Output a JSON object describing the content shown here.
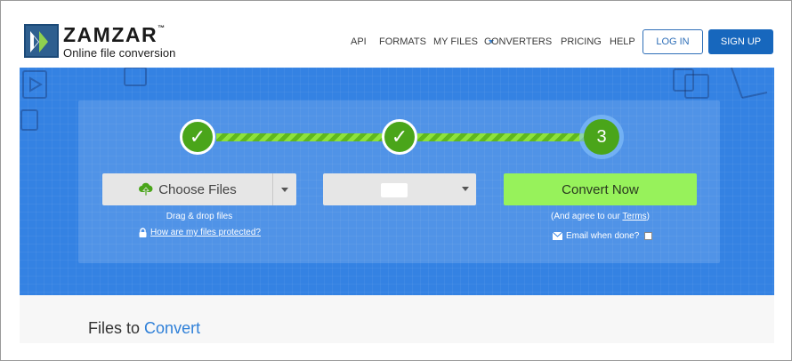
{
  "brand": {
    "name": "ZAMZAR",
    "trademark": "™",
    "tagline": "Online file conversion"
  },
  "nav": {
    "items": [
      {
        "id": "api",
        "label": "API"
      },
      {
        "id": "formats",
        "label": "FORMATS"
      },
      {
        "id": "my-files",
        "label": "MY FILES"
      },
      {
        "id": "converters",
        "label": "CONVERTERS"
      },
      {
        "id": "pricing",
        "label": "PRICING"
      },
      {
        "id": "help",
        "label": "HELP"
      }
    ],
    "login_label": "LOG IN",
    "signup_label": "SIGN UP"
  },
  "steps": {
    "step1_mark": "✓",
    "step2_mark": "✓",
    "step3_label": "3"
  },
  "converter": {
    "choose_files_label": "Choose Files",
    "drag_drop_text": "Drag & drop files",
    "protected_link": "How are my files protected?",
    "convert_label": "Convert Now",
    "agree_prefix": "(And agree to our ",
    "terms_link": "Terms",
    "agree_suffix": ")",
    "email_label": "Email when done?"
  },
  "files_section": {
    "title_prefix": "Files to",
    "title_highlight": "Convert"
  },
  "colors": {
    "hero_blue": "#3482e3",
    "step_green": "#4aa51a",
    "convert_green": "#97f25b",
    "signup_blue": "#1767bd",
    "accent_blue": "#2f80d8"
  }
}
